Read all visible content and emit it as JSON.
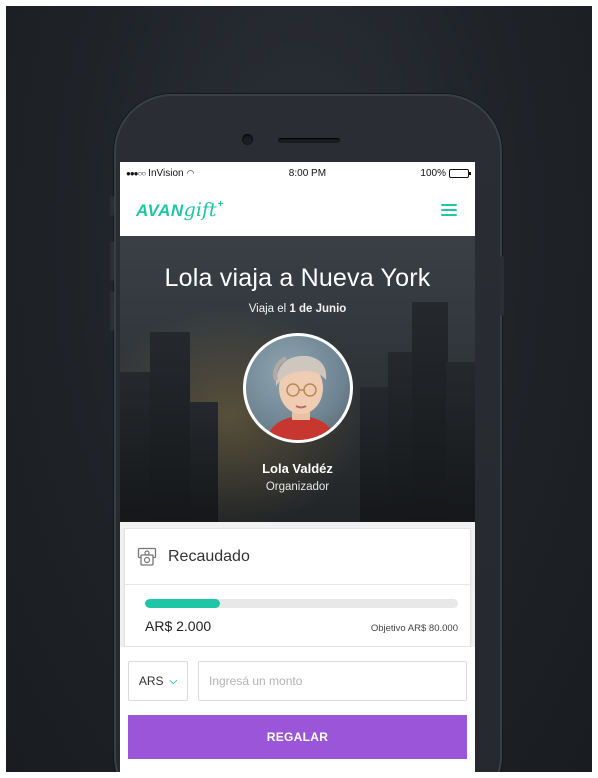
{
  "status_bar": {
    "carrier": "InVision",
    "time": "8:00 PM",
    "battery": "100%"
  },
  "header": {
    "logo_bold": "AVAN",
    "logo_script": "gift",
    "logo_mark": "+",
    "menu_icon": "hamburger-icon"
  },
  "hero": {
    "title": "Lola viaja a Nueva York",
    "subtitle_prefix": "Viaja el ",
    "subtitle_date": "1 de Junio",
    "organizer_name": "Lola Valdéz",
    "organizer_role": "Organizador"
  },
  "funds": {
    "title": "Recaudado",
    "icon": "money-icon",
    "raised": "AR$ 2.000",
    "goal": "Objetivo AR$ 80.000",
    "progress_fraction": 0.24
  },
  "gift_form": {
    "currency": "ARS",
    "amount_placeholder": "Ingresá un monto",
    "submit_label": "REGALAR"
  },
  "colors": {
    "accent": "#1ec6a5",
    "button": "#9a55d8",
    "background": "#1f2328"
  }
}
